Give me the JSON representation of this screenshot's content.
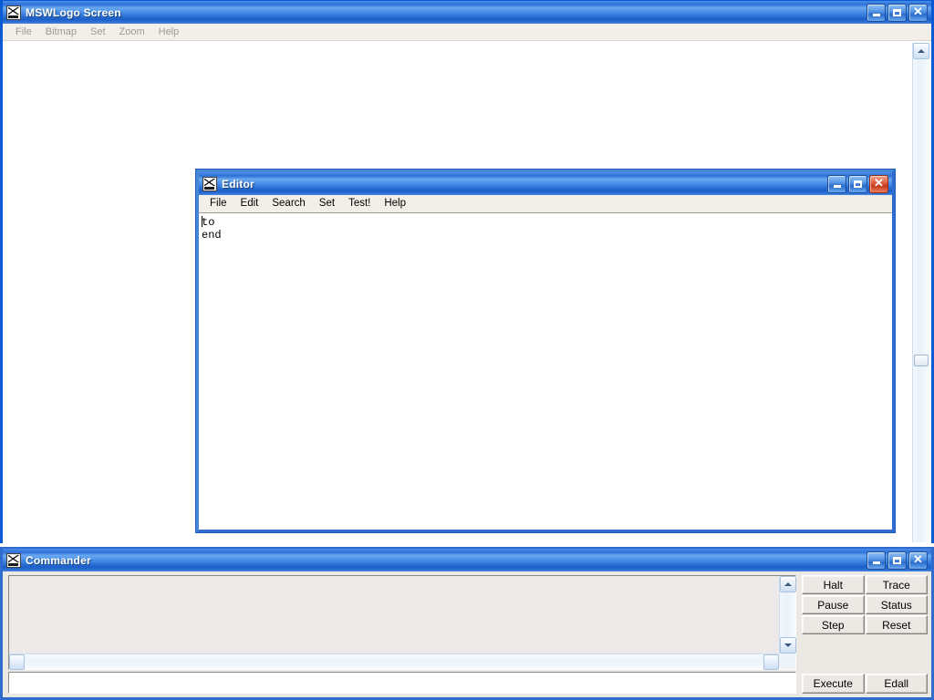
{
  "main_window": {
    "title": "MSWLogo Screen",
    "icon": "mswlogo-app-icon",
    "menu": [
      {
        "label": "File",
        "enabled": false
      },
      {
        "label": "Bitmap",
        "enabled": false
      },
      {
        "label": "Set",
        "enabled": false
      },
      {
        "label": "Zoom",
        "enabled": false
      },
      {
        "label": "Help",
        "enabled": false
      }
    ],
    "controls": {
      "minimize": "minimize-icon",
      "maximize": "maximize-icon",
      "close": "close-icon"
    },
    "scrollbar": {
      "orientation": "vertical",
      "up_arrow": "scroll-up-icon",
      "down_arrow": "scroll-down-icon"
    }
  },
  "editor_window": {
    "title": "Editor",
    "icon": "mswlogo-app-icon",
    "menu": [
      {
        "label": "File"
      },
      {
        "label": "Edit"
      },
      {
        "label": "Search"
      },
      {
        "label": "Set"
      },
      {
        "label": "Test!"
      },
      {
        "label": "Help"
      }
    ],
    "controls": {
      "minimize": "minimize-icon",
      "maximize": "maximize-icon",
      "close": "close-icon"
    },
    "text_lines": [
      "to",
      "end"
    ],
    "text_content": "to\nend"
  },
  "commander_window": {
    "title": "Commander",
    "icon": "mswlogo-app-icon",
    "controls": {
      "minimize": "minimize-icon",
      "maximize": "maximize-icon",
      "close": "close-icon"
    },
    "history": {
      "content": "",
      "vscroll": {
        "up_arrow": "scroll-up-icon",
        "down_arrow": "scroll-down-icon"
      },
      "hscroll": {
        "left_arrow": "scroll-left-icon",
        "right_arrow": "scroll-right-icon"
      }
    },
    "input": {
      "value": "",
      "placeholder": ""
    },
    "buttons": [
      {
        "label": "Halt"
      },
      {
        "label": "Trace"
      },
      {
        "label": "Pause"
      },
      {
        "label": "Status"
      },
      {
        "label": "Step"
      },
      {
        "label": "Reset"
      }
    ],
    "bottom_buttons": [
      {
        "label": "Execute"
      },
      {
        "label": "Edall"
      }
    ]
  },
  "colors": {
    "titlebar_blue": "#2f6ccd",
    "titlebar_light": "#6aa9f0",
    "close_red": "#c63a1c",
    "face": "#ece9e4",
    "canvas": "#ffffff"
  }
}
